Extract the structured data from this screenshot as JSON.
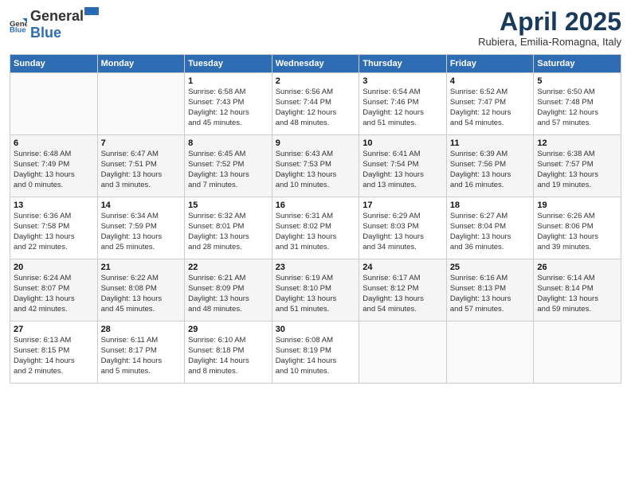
{
  "header": {
    "logo_general": "General",
    "logo_blue": "Blue",
    "title": "April 2025",
    "subtitle": "Rubiera, Emilia-Romagna, Italy"
  },
  "weekdays": [
    "Sunday",
    "Monday",
    "Tuesday",
    "Wednesday",
    "Thursday",
    "Friday",
    "Saturday"
  ],
  "weeks": [
    [
      {
        "day": "",
        "info": ""
      },
      {
        "day": "",
        "info": ""
      },
      {
        "day": "1",
        "info": "Sunrise: 6:58 AM\nSunset: 7:43 PM\nDaylight: 12 hours\nand 45 minutes."
      },
      {
        "day": "2",
        "info": "Sunrise: 6:56 AM\nSunset: 7:44 PM\nDaylight: 12 hours\nand 48 minutes."
      },
      {
        "day": "3",
        "info": "Sunrise: 6:54 AM\nSunset: 7:46 PM\nDaylight: 12 hours\nand 51 minutes."
      },
      {
        "day": "4",
        "info": "Sunrise: 6:52 AM\nSunset: 7:47 PM\nDaylight: 12 hours\nand 54 minutes."
      },
      {
        "day": "5",
        "info": "Sunrise: 6:50 AM\nSunset: 7:48 PM\nDaylight: 12 hours\nand 57 minutes."
      }
    ],
    [
      {
        "day": "6",
        "info": "Sunrise: 6:48 AM\nSunset: 7:49 PM\nDaylight: 13 hours\nand 0 minutes."
      },
      {
        "day": "7",
        "info": "Sunrise: 6:47 AM\nSunset: 7:51 PM\nDaylight: 13 hours\nand 3 minutes."
      },
      {
        "day": "8",
        "info": "Sunrise: 6:45 AM\nSunset: 7:52 PM\nDaylight: 13 hours\nand 7 minutes."
      },
      {
        "day": "9",
        "info": "Sunrise: 6:43 AM\nSunset: 7:53 PM\nDaylight: 13 hours\nand 10 minutes."
      },
      {
        "day": "10",
        "info": "Sunrise: 6:41 AM\nSunset: 7:54 PM\nDaylight: 13 hours\nand 13 minutes."
      },
      {
        "day": "11",
        "info": "Sunrise: 6:39 AM\nSunset: 7:56 PM\nDaylight: 13 hours\nand 16 minutes."
      },
      {
        "day": "12",
        "info": "Sunrise: 6:38 AM\nSunset: 7:57 PM\nDaylight: 13 hours\nand 19 minutes."
      }
    ],
    [
      {
        "day": "13",
        "info": "Sunrise: 6:36 AM\nSunset: 7:58 PM\nDaylight: 13 hours\nand 22 minutes."
      },
      {
        "day": "14",
        "info": "Sunrise: 6:34 AM\nSunset: 7:59 PM\nDaylight: 13 hours\nand 25 minutes."
      },
      {
        "day": "15",
        "info": "Sunrise: 6:32 AM\nSunset: 8:01 PM\nDaylight: 13 hours\nand 28 minutes."
      },
      {
        "day": "16",
        "info": "Sunrise: 6:31 AM\nSunset: 8:02 PM\nDaylight: 13 hours\nand 31 minutes."
      },
      {
        "day": "17",
        "info": "Sunrise: 6:29 AM\nSunset: 8:03 PM\nDaylight: 13 hours\nand 34 minutes."
      },
      {
        "day": "18",
        "info": "Sunrise: 6:27 AM\nSunset: 8:04 PM\nDaylight: 13 hours\nand 36 minutes."
      },
      {
        "day": "19",
        "info": "Sunrise: 6:26 AM\nSunset: 8:06 PM\nDaylight: 13 hours\nand 39 minutes."
      }
    ],
    [
      {
        "day": "20",
        "info": "Sunrise: 6:24 AM\nSunset: 8:07 PM\nDaylight: 13 hours\nand 42 minutes."
      },
      {
        "day": "21",
        "info": "Sunrise: 6:22 AM\nSunset: 8:08 PM\nDaylight: 13 hours\nand 45 minutes."
      },
      {
        "day": "22",
        "info": "Sunrise: 6:21 AM\nSunset: 8:09 PM\nDaylight: 13 hours\nand 48 minutes."
      },
      {
        "day": "23",
        "info": "Sunrise: 6:19 AM\nSunset: 8:10 PM\nDaylight: 13 hours\nand 51 minutes."
      },
      {
        "day": "24",
        "info": "Sunrise: 6:17 AM\nSunset: 8:12 PM\nDaylight: 13 hours\nand 54 minutes."
      },
      {
        "day": "25",
        "info": "Sunrise: 6:16 AM\nSunset: 8:13 PM\nDaylight: 13 hours\nand 57 minutes."
      },
      {
        "day": "26",
        "info": "Sunrise: 6:14 AM\nSunset: 8:14 PM\nDaylight: 13 hours\nand 59 minutes."
      }
    ],
    [
      {
        "day": "27",
        "info": "Sunrise: 6:13 AM\nSunset: 8:15 PM\nDaylight: 14 hours\nand 2 minutes."
      },
      {
        "day": "28",
        "info": "Sunrise: 6:11 AM\nSunset: 8:17 PM\nDaylight: 14 hours\nand 5 minutes."
      },
      {
        "day": "29",
        "info": "Sunrise: 6:10 AM\nSunset: 8:18 PM\nDaylight: 14 hours\nand 8 minutes."
      },
      {
        "day": "30",
        "info": "Sunrise: 6:08 AM\nSunset: 8:19 PM\nDaylight: 14 hours\nand 10 minutes."
      },
      {
        "day": "",
        "info": ""
      },
      {
        "day": "",
        "info": ""
      },
      {
        "day": "",
        "info": ""
      }
    ]
  ]
}
